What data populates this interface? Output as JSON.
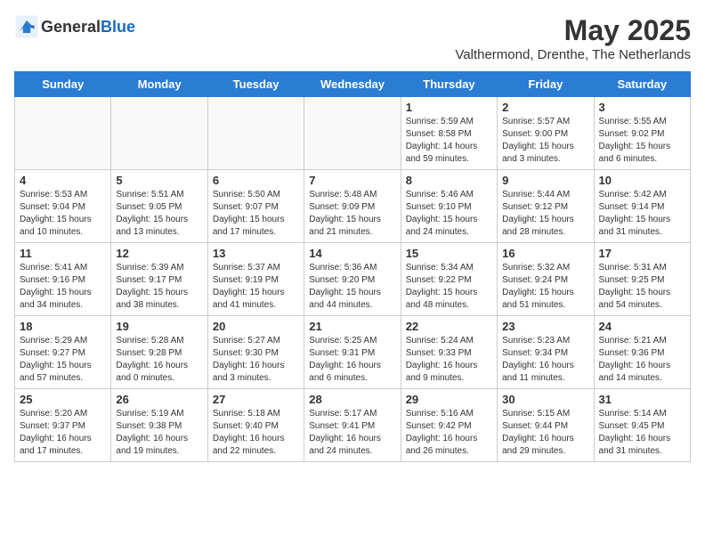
{
  "header": {
    "logo_general": "General",
    "logo_blue": "Blue",
    "month": "May 2025",
    "location": "Valthermond, Drenthe, The Netherlands"
  },
  "days_of_week": [
    "Sunday",
    "Monday",
    "Tuesday",
    "Wednesday",
    "Thursday",
    "Friday",
    "Saturday"
  ],
  "weeks": [
    [
      {
        "day": "",
        "info": ""
      },
      {
        "day": "",
        "info": ""
      },
      {
        "day": "",
        "info": ""
      },
      {
        "day": "",
        "info": ""
      },
      {
        "day": "1",
        "info": "Sunrise: 5:59 AM\nSunset: 8:58 PM\nDaylight: 14 hours and 59 minutes."
      },
      {
        "day": "2",
        "info": "Sunrise: 5:57 AM\nSunset: 9:00 PM\nDaylight: 15 hours and 3 minutes."
      },
      {
        "day": "3",
        "info": "Sunrise: 5:55 AM\nSunset: 9:02 PM\nDaylight: 15 hours and 6 minutes."
      }
    ],
    [
      {
        "day": "4",
        "info": "Sunrise: 5:53 AM\nSunset: 9:04 PM\nDaylight: 15 hours and 10 minutes."
      },
      {
        "day": "5",
        "info": "Sunrise: 5:51 AM\nSunset: 9:05 PM\nDaylight: 15 hours and 13 minutes."
      },
      {
        "day": "6",
        "info": "Sunrise: 5:50 AM\nSunset: 9:07 PM\nDaylight: 15 hours and 17 minutes."
      },
      {
        "day": "7",
        "info": "Sunrise: 5:48 AM\nSunset: 9:09 PM\nDaylight: 15 hours and 21 minutes."
      },
      {
        "day": "8",
        "info": "Sunrise: 5:46 AM\nSunset: 9:10 PM\nDaylight: 15 hours and 24 minutes."
      },
      {
        "day": "9",
        "info": "Sunrise: 5:44 AM\nSunset: 9:12 PM\nDaylight: 15 hours and 28 minutes."
      },
      {
        "day": "10",
        "info": "Sunrise: 5:42 AM\nSunset: 9:14 PM\nDaylight: 15 hours and 31 minutes."
      }
    ],
    [
      {
        "day": "11",
        "info": "Sunrise: 5:41 AM\nSunset: 9:16 PM\nDaylight: 15 hours and 34 minutes."
      },
      {
        "day": "12",
        "info": "Sunrise: 5:39 AM\nSunset: 9:17 PM\nDaylight: 15 hours and 38 minutes."
      },
      {
        "day": "13",
        "info": "Sunrise: 5:37 AM\nSunset: 9:19 PM\nDaylight: 15 hours and 41 minutes."
      },
      {
        "day": "14",
        "info": "Sunrise: 5:36 AM\nSunset: 9:20 PM\nDaylight: 15 hours and 44 minutes."
      },
      {
        "day": "15",
        "info": "Sunrise: 5:34 AM\nSunset: 9:22 PM\nDaylight: 15 hours and 48 minutes."
      },
      {
        "day": "16",
        "info": "Sunrise: 5:32 AM\nSunset: 9:24 PM\nDaylight: 15 hours and 51 minutes."
      },
      {
        "day": "17",
        "info": "Sunrise: 5:31 AM\nSunset: 9:25 PM\nDaylight: 15 hours and 54 minutes."
      }
    ],
    [
      {
        "day": "18",
        "info": "Sunrise: 5:29 AM\nSunset: 9:27 PM\nDaylight: 15 hours and 57 minutes."
      },
      {
        "day": "19",
        "info": "Sunrise: 5:28 AM\nSunset: 9:28 PM\nDaylight: 16 hours and 0 minutes."
      },
      {
        "day": "20",
        "info": "Sunrise: 5:27 AM\nSunset: 9:30 PM\nDaylight: 16 hours and 3 minutes."
      },
      {
        "day": "21",
        "info": "Sunrise: 5:25 AM\nSunset: 9:31 PM\nDaylight: 16 hours and 6 minutes."
      },
      {
        "day": "22",
        "info": "Sunrise: 5:24 AM\nSunset: 9:33 PM\nDaylight: 16 hours and 9 minutes."
      },
      {
        "day": "23",
        "info": "Sunrise: 5:23 AM\nSunset: 9:34 PM\nDaylight: 16 hours and 11 minutes."
      },
      {
        "day": "24",
        "info": "Sunrise: 5:21 AM\nSunset: 9:36 PM\nDaylight: 16 hours and 14 minutes."
      }
    ],
    [
      {
        "day": "25",
        "info": "Sunrise: 5:20 AM\nSunset: 9:37 PM\nDaylight: 16 hours and 17 minutes."
      },
      {
        "day": "26",
        "info": "Sunrise: 5:19 AM\nSunset: 9:38 PM\nDaylight: 16 hours and 19 minutes."
      },
      {
        "day": "27",
        "info": "Sunrise: 5:18 AM\nSunset: 9:40 PM\nDaylight: 16 hours and 22 minutes."
      },
      {
        "day": "28",
        "info": "Sunrise: 5:17 AM\nSunset: 9:41 PM\nDaylight: 16 hours and 24 minutes."
      },
      {
        "day": "29",
        "info": "Sunrise: 5:16 AM\nSunset: 9:42 PM\nDaylight: 16 hours and 26 minutes."
      },
      {
        "day": "30",
        "info": "Sunrise: 5:15 AM\nSunset: 9:44 PM\nDaylight: 16 hours and 29 minutes."
      },
      {
        "day": "31",
        "info": "Sunrise: 5:14 AM\nSunset: 9:45 PM\nDaylight: 16 hours and 31 minutes."
      }
    ]
  ]
}
